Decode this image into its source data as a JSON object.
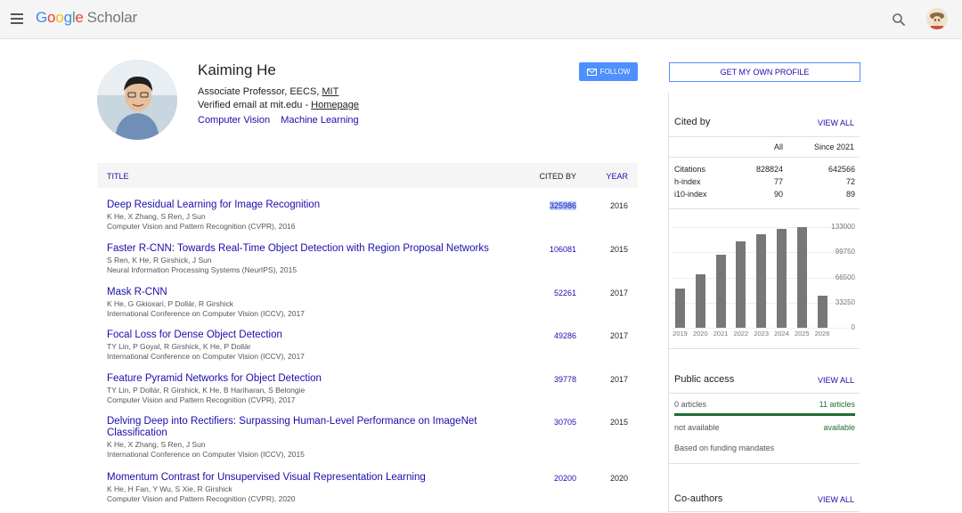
{
  "header": {
    "logo_google": "Google",
    "logo_scholar": "Scholar"
  },
  "profile": {
    "name": "Kaiming He",
    "affiliation_prefix": "Associate Professor, EECS, ",
    "affiliation_link": "MIT",
    "email_prefix": "Verified email at mit.edu - ",
    "homepage": "Homepage",
    "interests": [
      "Computer Vision",
      "Machine Learning"
    ],
    "follow_label": "FOLLOW"
  },
  "table": {
    "headers": {
      "title": "TITLE",
      "cited": "CITED BY",
      "year": "YEAR"
    },
    "rows": [
      {
        "title": "Deep Residual Learning for Image Recognition",
        "authors": "K He, X Zhang, S Ren, J Sun",
        "venue": "Computer Vision and Pattern Recognition (CVPR), 2016",
        "cited": "325986",
        "year": "2016"
      },
      {
        "title": "Faster R-CNN: Towards Real-Time Object Detection with Region Proposal Networks",
        "authors": "S Ren, K He, R Girshick, J Sun",
        "venue": "Neural Information Processing Systems (NeurIPS), 2015",
        "cited": "106081",
        "year": "2015"
      },
      {
        "title": "Mask R-CNN",
        "authors": "K He, G Gkioxari, P Dollár, R Girshick",
        "venue": "International Conference on Computer Vision (ICCV), 2017",
        "cited": "52261",
        "year": "2017"
      },
      {
        "title": "Focal Loss for Dense Object Detection",
        "authors": "TY Lin, P Goyal, R Girshick, K He, P Dollár",
        "venue": "International Conference on Computer Vision (ICCV), 2017",
        "cited": "49286",
        "year": "2017"
      },
      {
        "title": "Feature Pyramid Networks for Object Detection",
        "authors": "TY Lin, P Dollár, R Girshick, K He, B Hariharan, S Belongie",
        "venue": "Computer Vision and Pattern Recognition (CVPR), 2017",
        "cited": "39778",
        "year": "2017"
      },
      {
        "title": "Delving Deep into Rectifiers: Surpassing Human-Level Performance on ImageNet Classification",
        "authors": "K He, X Zhang, S Ren, J Sun",
        "venue": "International Conference on Computer Vision (ICCV), 2015",
        "cited": "30705",
        "year": "2015"
      },
      {
        "title": "Momentum Contrast for Unsupervised Visual Representation Learning",
        "authors": "K He, H Fan, Y Wu, S Xie, R Girshick",
        "venue": "Computer Vision and Pattern Recognition (CVPR), 2020",
        "cited": "20200",
        "year": "2020"
      }
    ]
  },
  "sidebar": {
    "own_profile": "GET MY OWN PROFILE",
    "cited_by": {
      "title": "Cited by",
      "view_all": "VIEW ALL",
      "col_all": "All",
      "col_since": "Since 2021",
      "metrics": [
        {
          "label": "Citations",
          "all": "828824",
          "since": "642566"
        },
        {
          "label": "h-index",
          "all": "77",
          "since": "72"
        },
        {
          "label": "i10-index",
          "all": "90",
          "since": "89"
        }
      ]
    },
    "public_access": {
      "title": "Public access",
      "view_all": "VIEW ALL",
      "not_available_count": "0 articles",
      "available_count": "11 articles",
      "not_available": "not available",
      "available": "available",
      "note": "Based on funding mandates",
      "available_color": "#1e6e2e"
    },
    "coauthors": {
      "title": "Co-authors",
      "view_all": "VIEW ALL"
    }
  },
  "chart_data": {
    "type": "bar",
    "categories": [
      "2019",
      "2020",
      "2021",
      "2022",
      "2023",
      "2024",
      "2025",
      "2026"
    ],
    "values": [
      52000,
      71000,
      96000,
      114000,
      124000,
      131000,
      133000,
      42000
    ],
    "yticks": [
      "133000",
      "99750",
      "66500",
      "33250",
      "0"
    ],
    "ylim": [
      0,
      133000
    ],
    "bar_color": "#777777"
  }
}
